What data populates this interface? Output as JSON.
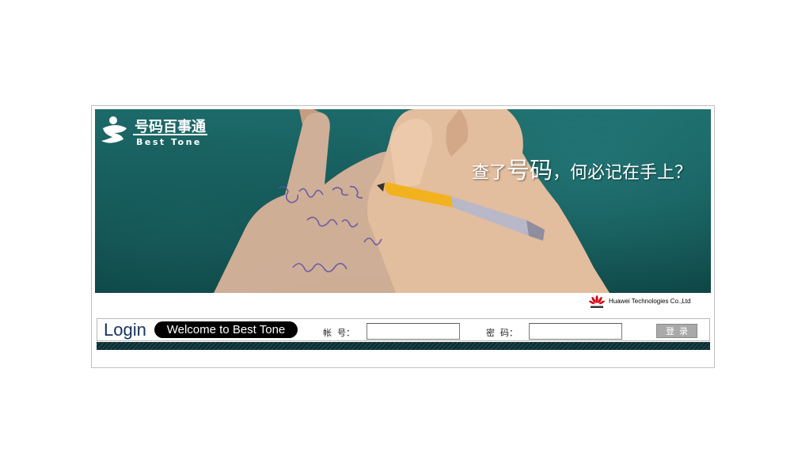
{
  "banner": {
    "logo": {
      "name": "号码百事通",
      "subtitle": "Best Tone"
    },
    "slogan": {
      "part1": "查了",
      "part2": "号码",
      "part3": "，何必记在手上？"
    }
  },
  "vendor": {
    "logo_icon": "huawei-logo-icon",
    "text": "Huawei Technologies Co.,Ltd"
  },
  "login": {
    "title": "Login",
    "welcome": "Welcome to Best Tone",
    "account_label": "帐  号：",
    "account_value": "",
    "password_label": "密  码：",
    "password_value": "",
    "submit_label": "登录"
  },
  "colors": {
    "banner_teal": "#1d6a6a",
    "login_title": "#16325c",
    "button_gray": "#a9a9a9",
    "stripe_dark": "#0e2a2e"
  }
}
